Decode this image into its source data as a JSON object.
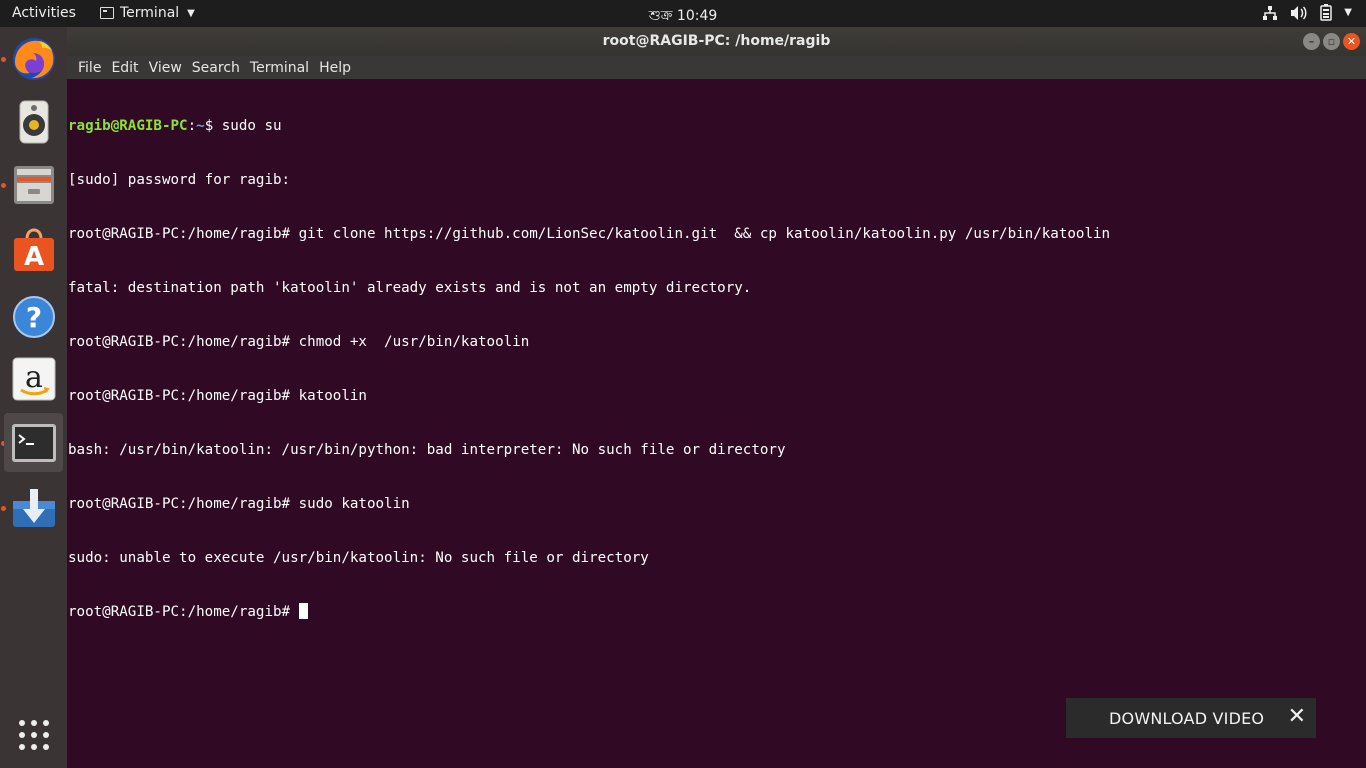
{
  "topbar": {
    "activities": "Activities",
    "app_menu": "Terminal",
    "clock": "শুক্র 10:49"
  },
  "window": {
    "title": "root@RAGIB-PC: /home/ragib",
    "menu": [
      "File",
      "Edit",
      "View",
      "Search",
      "Terminal",
      "Help"
    ]
  },
  "terminal": {
    "user_prompt_user": "ragib@RAGIB-PC",
    "user_prompt_path": "~",
    "user_prompt_cmd": "$ sudo su",
    "lines": [
      "[sudo] password for ragib: ",
      "root@RAGIB-PC:/home/ragib# git clone https://github.com/LionSec/katoolin.git  && cp katoolin/katoolin.py /usr/bin/katoolin",
      "fatal: destination path 'katoolin' already exists and is not an empty directory.",
      "root@RAGIB-PC:/home/ragib# chmod +x  /usr/bin/katoolin",
      "root@RAGIB-PC:/home/ragib# katoolin",
      "bash: /usr/bin/katoolin: /usr/bin/python: bad interpreter: No such file or directory",
      "root@RAGIB-PC:/home/ragib# sudo katoolin",
      "sudo: unable to execute /usr/bin/katoolin: No such file or directory"
    ],
    "last_prompt": "root@RAGIB-PC:/home/ragib# "
  },
  "download_banner": {
    "label": "DOWNLOAD VIDEO",
    "close": "✕"
  },
  "colors": {
    "terminal_bg": "#300a24",
    "prompt_user": "#8ae234",
    "prompt_path": "#729fcf",
    "accent": "#e95420"
  },
  "dock_icons": [
    "firefox-icon",
    "rhythmbox-icon",
    "files-icon",
    "software-center-icon",
    "help-icon",
    "amazon-icon",
    "terminal-icon",
    "downloader-icon",
    "show-apps-icon"
  ]
}
